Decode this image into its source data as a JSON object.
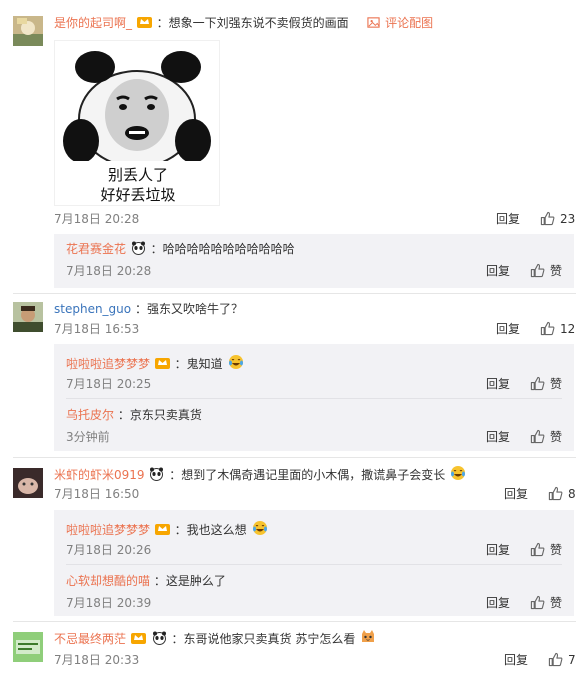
{
  "icons": {
    "like": "thumbs-up-icon",
    "pic": "image-icon",
    "vip_badge": "vip-crown-icon",
    "panda": "panda-emoji-icon",
    "cry_laugh": "laugh-cry-emoji-icon",
    "cat": "cat-emoji-icon"
  },
  "colors": {
    "username": "#eb7350",
    "link": "#3a74bb",
    "meta": "#808080",
    "reply_bg": "#f2f2f5"
  },
  "comments": [
    {
      "user": "是你的起司啊_",
      "text": "：想象一下刘强东说不卖假货的画面",
      "pic_link": "评论配图",
      "pic_caption_1": "别丢人了",
      "pic_caption_2": "好好丢垃圾",
      "time": "7月18日 20:28",
      "reply": "回复",
      "likes": "23",
      "replies": [
        {
          "user": "花君赛金花",
          "text": "：哈哈哈哈哈哈哈哈哈哈哈",
          "time": "7月18日 20:28",
          "reply": "回复",
          "likes": "赞"
        }
      ]
    },
    {
      "user": "stephen_guo",
      "text": "：强东又吹啥牛了？",
      "time": "7月18日 16:53",
      "reply": "回复",
      "likes": "12",
      "replies": [
        {
          "user": "啦啦啦追梦梦梦",
          "text": "：鬼知道",
          "time": "7月18日 20:25",
          "reply": "回复",
          "likes": "赞"
        },
        {
          "user": "乌托皮尔",
          "text": "：京东只卖真货",
          "time": "3分钟前",
          "reply": "回复",
          "likes": "赞"
        }
      ]
    },
    {
      "user": "米虾的虾米0919",
      "text": "：想到了木偶奇遇记里面的小木偶，撒谎鼻子会变长",
      "time": "7月18日 16:50",
      "reply": "回复",
      "likes": "8",
      "replies": [
        {
          "user": "啦啦啦追梦梦梦",
          "text": "：我也这么想",
          "time": "7月18日 20:26",
          "reply": "回复",
          "likes": "赞"
        },
        {
          "user": "心软却想酷的喵",
          "text": "：这是肿么了",
          "time": "7月18日 20:39",
          "reply": "回复",
          "likes": "赞"
        }
      ]
    },
    {
      "user": "不忌最终两茫",
      "text": "：东哥说他家只卖真货  苏宁怎么看",
      "time": "7月18日 20:33",
      "reply": "回复",
      "likes": "7"
    }
  ]
}
